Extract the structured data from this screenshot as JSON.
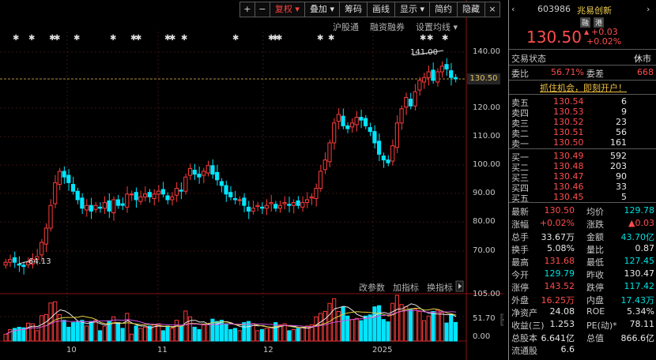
{
  "toolbar": {
    "plus": "+",
    "minus": "−",
    "fuquan": "复权",
    "diejia": "叠加",
    "chouma": "筹码",
    "huaxian": "画线",
    "xianshi": "显示",
    "jianyue": "简约",
    "yincang": "隐藏",
    "close": "×"
  },
  "chart_links": {
    "hgt": "沪股通",
    "rzrq": "融资融券",
    "setting": "设置均线"
  },
  "price_axis": [
    "140.00",
    "130.50",
    "120.00",
    "110.00",
    "100.00",
    "90.00",
    "80.00",
    "70.00"
  ],
  "current_price_tag": "130.50",
  "high_label": "141.00",
  "low_label": "64.13",
  "volume_tools": {
    "params": "改参数",
    "add": "加指标",
    "switch": "换指标"
  },
  "volume_axis": [
    "105.00",
    "51.70",
    "0.00"
  ],
  "x_axis": [
    "10",
    "11",
    "12",
    "2025"
  ],
  "stock": {
    "code": "603986",
    "name": "兆易创新",
    "badge1": "融",
    "badge2": "港"
  },
  "quote": {
    "price": "130.50",
    "change": "+0.03",
    "change_pct": "+0.02%"
  },
  "status": {
    "label": "交易状态",
    "value": "休市"
  },
  "weibi": {
    "label": "委比",
    "value": "56.71%",
    "label2": "委差",
    "value2": "668"
  },
  "promo": "抓住机会，即刻开户！",
  "asks": [
    {
      "label": "卖五",
      "price": "130.54",
      "vol": "6"
    },
    {
      "label": "卖四",
      "price": "130.53",
      "vol": "9"
    },
    {
      "label": "卖三",
      "price": "130.52",
      "vol": "23"
    },
    {
      "label": "卖二",
      "price": "130.51",
      "vol": "56"
    },
    {
      "label": "卖一",
      "price": "130.50",
      "vol": "161"
    }
  ],
  "bids": [
    {
      "label": "买一",
      "price": "130.49",
      "vol": "592"
    },
    {
      "label": "买二",
      "price": "130.48",
      "vol": "203"
    },
    {
      "label": "买三",
      "price": "130.47",
      "vol": "90"
    },
    {
      "label": "买四",
      "price": "130.46",
      "vol": "33"
    },
    {
      "label": "买五",
      "price": "130.45",
      "vol": "5"
    }
  ],
  "stats": [
    {
      "l1": "最新",
      "v1": "130.50",
      "c1": "red",
      "l2": "均价",
      "v2": "129.78",
      "c2": "green"
    },
    {
      "l1": "涨幅",
      "v1": "+0.02%",
      "c1": "red",
      "l2": "涨跌",
      "v2": "▲0.03",
      "c2": "red"
    },
    {
      "l1": "总手",
      "v1": "33.67万",
      "c1": "white",
      "l2": "金额",
      "v2": "43.70亿",
      "c2": "green"
    },
    {
      "l1": "换手",
      "v1": "5.08%",
      "c1": "white",
      "l2": "量比",
      "v2": "0.87",
      "c2": "white"
    },
    {
      "l1": "最高",
      "v1": "131.68",
      "c1": "red",
      "l2": "最低",
      "v2": "127.45",
      "c2": "green"
    },
    {
      "l1": "今开",
      "v1": "129.79",
      "c1": "green",
      "l2": "昨收",
      "v2": "130.47",
      "c2": "white"
    },
    {
      "l1": "涨停",
      "v1": "143.52",
      "c1": "red",
      "l2": "跌停",
      "v2": "117.42",
      "c2": "green"
    },
    {
      "l1": "外盘",
      "v1": "16.25万",
      "c1": "red",
      "l2": "内盘",
      "v2": "17.43万",
      "c2": "green"
    },
    {
      "l1": "净资产",
      "v1": "24.08",
      "c1": "white",
      "l2": "ROE",
      "v2": "5.34%",
      "c2": "white"
    },
    {
      "l1": "收益(三)",
      "v1": "1.253",
      "c1": "white",
      "l2": "PE(动)*",
      "v2": "78.11",
      "c2": "white"
    },
    {
      "l1": "总股本",
      "v1": "6.641亿",
      "c1": "white",
      "l2": "总值",
      "v2": "866.6亿",
      "c2": "white"
    },
    {
      "l1": "流通股",
      "v1": "6.6",
      "c1": "white",
      "l2": "",
      "v2": "",
      "c2": "white"
    }
  ],
  "colors": {
    "up": "#ff3b3b",
    "down": "#00e5ff",
    "ma_yellow": "#e0d040",
    "ma_purple": "#d050e0",
    "ma_white": "#e8e8e8"
  }
}
